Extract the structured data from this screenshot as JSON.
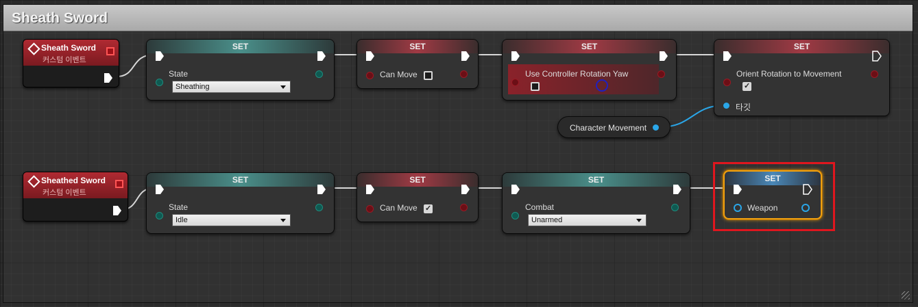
{
  "comment": {
    "title": "Sheath Sword"
  },
  "row1": {
    "event": {
      "title": "Sheath Sword",
      "subtitle": "커스텀 이벤트"
    },
    "set_state": {
      "title": "SET",
      "pin_label": "State",
      "value": "Sheathing"
    },
    "set_can_move": {
      "title": "SET",
      "pin_label": "Can Move",
      "checked": false
    },
    "set_use_controller": {
      "title": "SET",
      "pin_label": "Use Controller Rotation Yaw",
      "checked": false
    },
    "set_orient": {
      "title": "SET",
      "pin_label": "Orient Rotation to Movement",
      "checked": true,
      "target_label": "타깃"
    },
    "character_movement": {
      "label": "Character Movement"
    }
  },
  "row2": {
    "event": {
      "title": "Sheathed Sword",
      "subtitle": "커스텀 이벤트"
    },
    "set_state": {
      "title": "SET",
      "pin_label": "State",
      "value": "Idle"
    },
    "set_can_move": {
      "title": "SET",
      "pin_label": "Can Move",
      "checked": true
    },
    "set_combat": {
      "title": "SET",
      "pin_label": "Combat",
      "value": "Unarmed"
    },
    "set_weapon": {
      "title": "SET",
      "pin_label": "Weapon",
      "selected": true
    }
  },
  "colors": {
    "exec_wire": "#d8d8d8",
    "object_pin": "#2aa6e8",
    "bool_pin": "#8c1520",
    "byte_pin": "#1e8c7e",
    "event_header": "#b02a32",
    "selection": "#f0a010",
    "highlight_frame": "#e0161e"
  },
  "icons": [
    "event-diamond-icon",
    "exec-arrow-icon",
    "delegate-square-icon",
    "checkmark-icon",
    "dropdown-arrow-icon",
    "resize-grip-icon"
  ]
}
